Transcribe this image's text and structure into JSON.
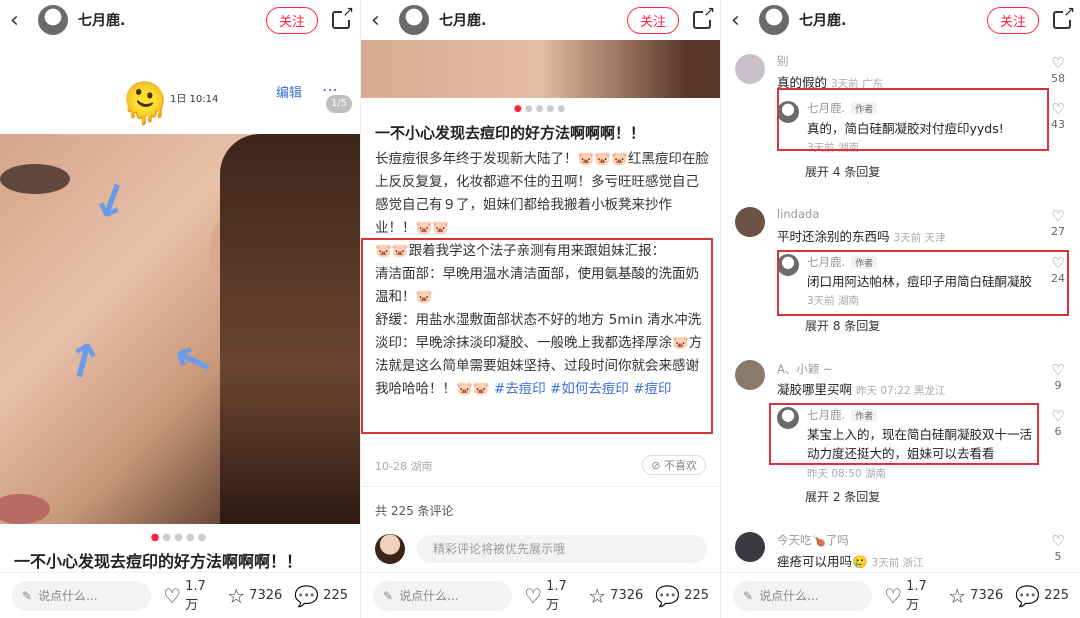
{
  "header": {
    "back": "‹",
    "username": "七月鹿.",
    "follow_label": "关注"
  },
  "bottom": {
    "say_placeholder": "说点什么...",
    "likes": "1.7万",
    "collects": "7326",
    "comments": "225"
  },
  "panel1": {
    "date": "1日 10:14",
    "edit": "编辑",
    "pager": "1/5",
    "title": "一不小心发现去痘印的好方法啊啊啊！！"
  },
  "panel2": {
    "title": "一不小心发现去痘印的好方法啊啊啊！！",
    "para1": "长痘痘很多年终于发现新大陆了！🐷🐷🐷红黑痘印在脸上反反复复，化妆都遮不住的丑啊！多亏旺旺感觉自己感觉自己有９了，姐妹们都给我搬着小板凳来抄作业！！🐷🐷",
    "para2": "🐷🐷跟着我学这个法子亲测有用来跟姐妹汇报：",
    "para3": "清洁面部：早晚用温水清洁面部，使用氨基酸的洗面奶温和！🐷",
    "para4": "舒缓：用盐水湿敷面部状态不好的地方 5min 清水冲洗",
    "para5": "淡印：早晚涂抹淡印凝胶、一般晚上我都选择厚涂🐷方法就是这么简单需要姐妹坚持、过段时间你就会来感谢我哈哈哈！！🐷🐷",
    "tags": [
      "#去痘印",
      "#如何去痘印",
      "#痘印"
    ],
    "meta": "10-28 湖南",
    "dislike": "不喜欢",
    "comment_count": "共 225 条评论",
    "comment_placeholder": "精彩评论将被优先展示哦"
  },
  "panel3": {
    "author_badge": "作者",
    "comments": [
      {
        "name": "别",
        "text": "真的假的",
        "meta": "3天前 广东",
        "likes": "58",
        "reply": {
          "name": "七月鹿.",
          "text": "真的，简白硅酮凝胶对付痘印yyds!",
          "meta": "3天前 湖南",
          "likes": "43"
        },
        "expand": "展开 4 条回复"
      },
      {
        "name": "lindada",
        "text": "平时还涂别的东西吗",
        "meta": "3天前 天津",
        "likes": "27",
        "reply": {
          "name": "七月鹿.",
          "text": "闭口用阿达帕林，痘印子用简白硅酮凝胶",
          "meta": "3天前 湖南",
          "likes": "24"
        },
        "expand": "展开 8 条回复"
      },
      {
        "name": "A、小颖 ~",
        "text": "凝胶哪里买啊",
        "meta": "昨天 07:22 黑龙江",
        "likes": "9",
        "reply": {
          "name": "七月鹿.",
          "text": "某宝上入的，现在简白硅酮凝胶双十一活动力度还挺大的，姐妹可以去看看",
          "line1": "某宝上入的，现在简白硅酮凝胶双十一活",
          "line2": "动力度还挺大的，姐妹可以去看看",
          "meta": "昨天 08:50 湖南",
          "likes": "6"
        },
        "expand": "展开 2 条回复"
      },
      {
        "name": "今天吃🍗了吗",
        "text": "痤疮可以用吗🥲",
        "meta": "3天前 浙江",
        "likes": "5"
      }
    ]
  }
}
